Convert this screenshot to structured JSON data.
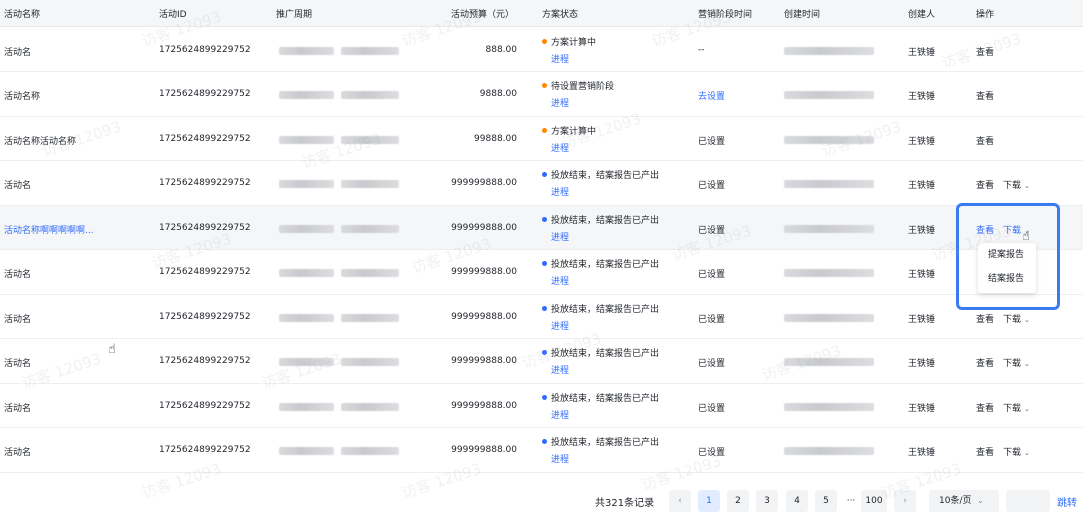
{
  "header": {
    "cols": [
      "活动名称",
      "活动ID",
      "推广周期",
      "活动预算（元）",
      "方案状态",
      "营销阶段时间",
      "创建时间",
      "创建人",
      "操作"
    ]
  },
  "rows": [
    {
      "name": "活动名",
      "id": "1725624899229752",
      "budget": "888.00",
      "status": "方案计算中",
      "status_link": "进程",
      "stage": "--",
      "creator": "王铁锤",
      "op1": "查看",
      "op2": ""
    },
    {
      "name": "活动名称",
      "id": "1725624899229752",
      "budget": "9888.00",
      "status": "待设置营销阶段",
      "status_link": "进程",
      "stage": "去设置",
      "creator": "王铁锤",
      "op1": "查看",
      "op2": ""
    },
    {
      "name": "活动名称活动名称",
      "id": "1725624899229752",
      "budget": "99888.00",
      "status": "方案计算中",
      "status_link": "进程",
      "stage": "已设置",
      "creator": "王铁锤",
      "op1": "查看",
      "op2": ""
    },
    {
      "name": "活动名",
      "id": "1725624899229752",
      "budget": "999999888.00",
      "status": "投放结束，结案报告已产出",
      "status_link": "进程",
      "stage": "已设置",
      "creator": "王铁锤",
      "op1": "查看",
      "op2": "下载"
    },
    {
      "name": "活动名称啊啊啊啊啊...",
      "id": "1725624899229752",
      "budget": "999999888.00",
      "status": "投放结束，结案报告已产出",
      "status_link": "进程",
      "stage": "已设置",
      "creator": "王铁锤",
      "op1": "查看",
      "op2": "下载"
    },
    {
      "name": "活动名",
      "id": "1725624899229752",
      "budget": "999999888.00",
      "status": "投放结束，结案报告已产出",
      "status_link": "进程",
      "stage": "已设置",
      "creator": "王铁锤",
      "op1": "",
      "op2": ""
    },
    {
      "name": "活动名",
      "id": "1725624899229752",
      "budget": "999999888.00",
      "status": "投放结束，结案报告已产出",
      "status_link": "进程",
      "stage": "已设置",
      "creator": "王铁锤",
      "op1": "查看",
      "op2": "下载"
    },
    {
      "name": "活动名",
      "id": "1725624899229752",
      "budget": "999999888.00",
      "status": "投放结束，结案报告已产出",
      "status_link": "进程",
      "stage": "已设置",
      "creator": "王铁锤",
      "op1": "查看",
      "op2": "下载"
    },
    {
      "name": "活动名",
      "id": "1725624899229752",
      "budget": "999999888.00",
      "status": "投放结束，结案报告已产出",
      "status_link": "进程",
      "stage": "已设置",
      "creator": "王铁锤",
      "op1": "查看",
      "op2": "下载"
    },
    {
      "name": "活动名",
      "id": "1725624899229752",
      "budget": "999999888.00",
      "status": "投放结束，结案报告已产出",
      "status_link": "进程",
      "stage": "已设置",
      "creator": "王铁锤",
      "op1": "查看",
      "op2": "下载"
    }
  ],
  "dropdown": {
    "items": [
      "提案报告",
      "结案报告"
    ]
  },
  "watermark": "访客 12093",
  "pagination": {
    "total": "共321条记录",
    "prev": "‹",
    "next": "›",
    "pages": [
      "1",
      "2",
      "3",
      "4",
      "5",
      "···",
      "100"
    ],
    "page_size": "10条/页",
    "jump": "跳转"
  },
  "colors": {
    "link": "#2f6bff",
    "orange_dot": "#ff8800",
    "blue_dot": "#2f6bff",
    "highlight": "#3a7bf0"
  }
}
